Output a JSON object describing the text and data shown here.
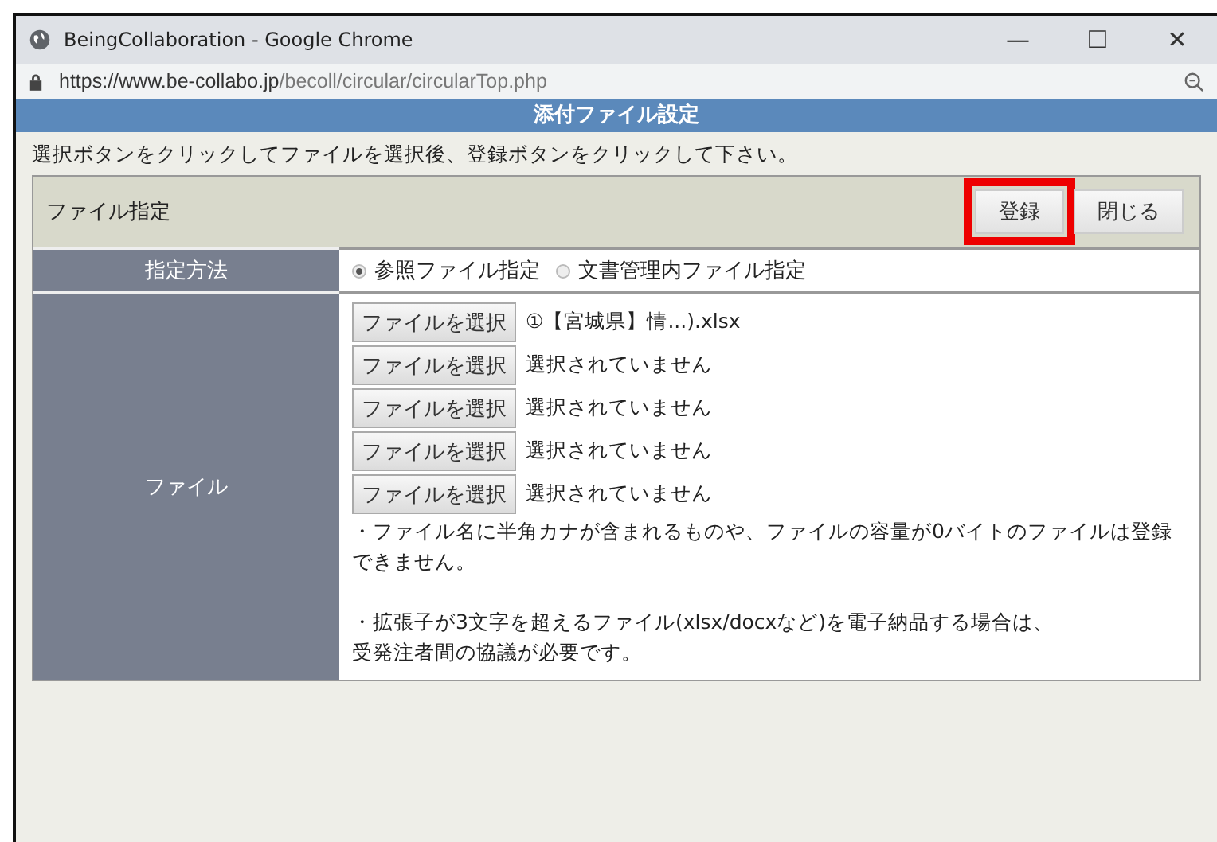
{
  "window": {
    "title": "BeingCollaboration - Google Chrome",
    "controls": [
      "—",
      "☐",
      "✕"
    ]
  },
  "address_bar": {
    "host": "https://www.be-collabo.jp",
    "path": "/becoll/circular/circularTop.php"
  },
  "dialog": {
    "title": "添付ファイル設定",
    "instruction": "選択ボタンをクリックしてファイルを選択後、登録ボタンをクリックして下さい。",
    "panel": {
      "title": "ファイル指定",
      "buttons": [
        {
          "label": "登録",
          "highlighted": true
        },
        {
          "label": "閉じる",
          "highlighted": false
        }
      ]
    },
    "method": {
      "label": "指定方法",
      "options": [
        {
          "label": "参照ファイル指定",
          "selected": true
        },
        {
          "label": "文書管理内ファイル指定",
          "selected": false
        }
      ]
    },
    "files": {
      "label": "ファイル",
      "rows": [
        {
          "button": "ファイルを選択",
          "status": "①【宮城県】情...).xlsx"
        },
        {
          "button": "ファイルを選択",
          "status": "選択されていません"
        },
        {
          "button": "ファイルを選択",
          "status": "選択されていません"
        },
        {
          "button": "ファイルを選択",
          "status": "選択されていません"
        },
        {
          "button": "ファイルを選択",
          "status": "選択されていません"
        }
      ],
      "notes": [
        {
          "lines": [
            "・ファイル名に半角カナが含まれるものや、ファイルの容量が0バイトのファイルは登録できません。"
          ]
        },
        {
          "lines": [
            "・拡張子が3文字を超えるファイル(xlsx/docxなど)を電子納品する場合は、",
            "受発注者間の協議が必要です。"
          ]
        }
      ]
    }
  }
}
